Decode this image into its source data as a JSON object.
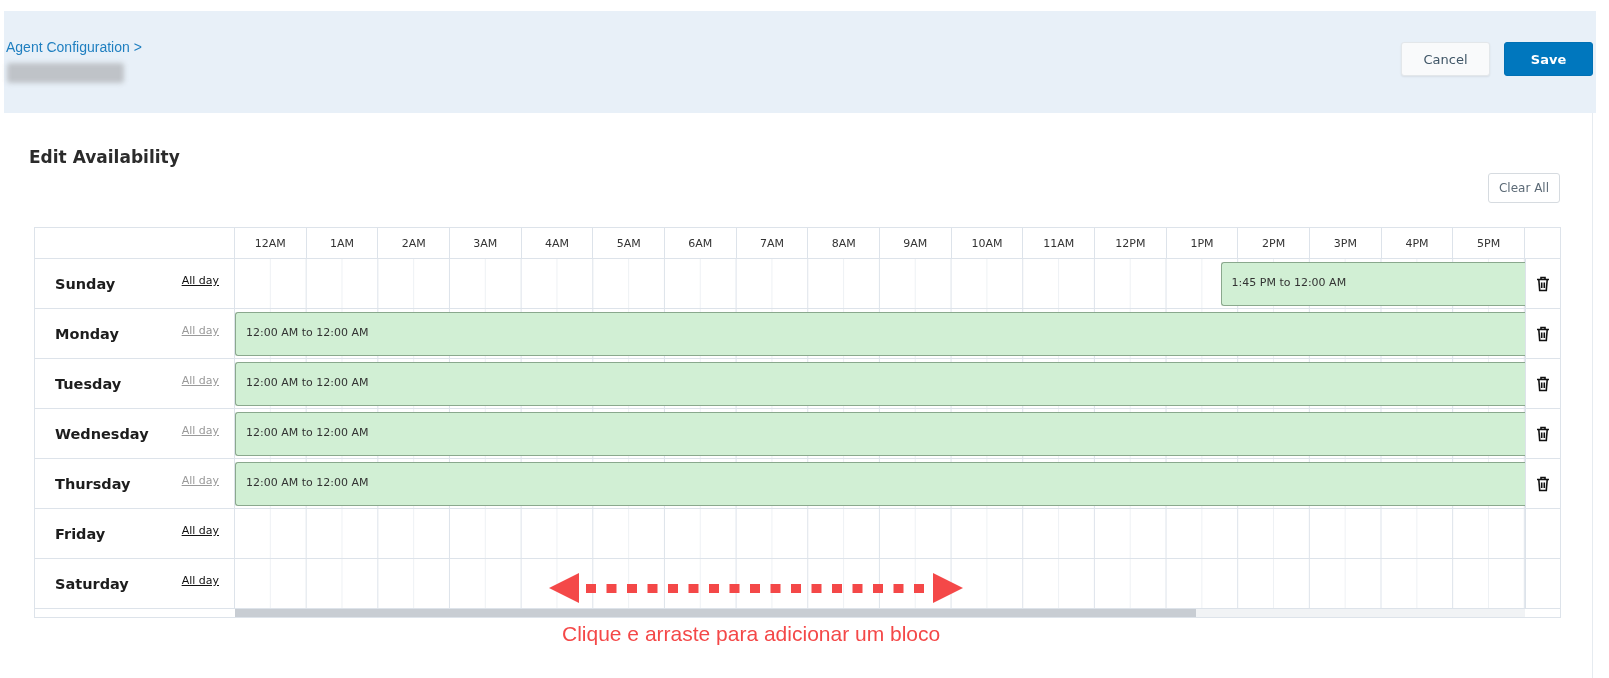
{
  "breadcrumb": {
    "link": "Agent Configuration >"
  },
  "header_buttons": [
    {
      "label": "Cancel",
      "kind": "secondary"
    },
    {
      "label": "Save",
      "kind": "primary"
    }
  ],
  "section_title": "Edit Availability",
  "clear_all_button": "Clear All",
  "hours": [
    "12AM",
    "1AM",
    "2AM",
    "3AM",
    "4AM",
    "5AM",
    "6AM",
    "7AM",
    "8AM",
    "9AM",
    "10AM",
    "11AM",
    "12PM",
    "1PM",
    "2PM",
    "3PM",
    "4PM",
    "5PM"
  ],
  "days": [
    {
      "name": "Sunday",
      "all_day": {
        "label": "All day",
        "disabled": false
      },
      "block": {
        "label": "1:45 PM to 12:00 AM",
        "level": 0.236
      }
    },
    {
      "name": "Monday",
      "all_day": {
        "label": "All day",
        "disabled": true
      },
      "block": {
        "label": "12:00 AM to 12:00 AM",
        "level": 1
      }
    },
    {
      "name": "Tuesday",
      "all_day": {
        "label": "All day",
        "disabled": true
      },
      "block": {
        "label": "12:00 AM to 12:00 AM",
        "level": 1
      }
    },
    {
      "name": "Wednesday",
      "all_day": {
        "label": "All day",
        "disabled": true
      },
      "block": {
        "label": "12:00 AM to 12:00 AM",
        "level": 1
      }
    },
    {
      "name": "Thursday",
      "all_day": {
        "label": "All day",
        "disabled": true
      },
      "block": {
        "label": "12:00 AM to 12:00 AM",
        "level": 1
      }
    },
    {
      "name": "Friday",
      "all_day": {
        "label": "All day",
        "disabled": false
      }
    },
    {
      "name": "Saturday",
      "all_day": {
        "label": "All day",
        "disabled": false
      }
    }
  ],
  "annotation": {
    "text": "Clique e arraste para adicionar um bloco"
  }
}
